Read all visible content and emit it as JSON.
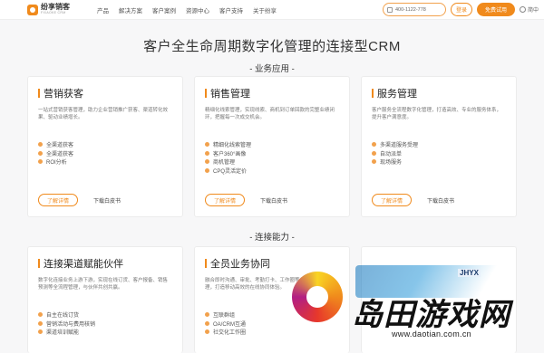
{
  "nav": {
    "logo_name": "纷享销客",
    "logo_sub": "FXIAOKE CRM",
    "menu": [
      "产品",
      "解决方案",
      "客户案例",
      "资源中心",
      "客户支持",
      "关于纷享"
    ],
    "phone_text": "400-1122-778",
    "login_label": "登录",
    "trial_label": "免费试用",
    "lang_label": "简中"
  },
  "hero": {
    "title": "客户全生命周期数字化管理的连接型CRM"
  },
  "sections": {
    "business": "- 业务应用 -",
    "connect": "- 连接能力 -"
  },
  "cards": [
    {
      "title": "营销获客",
      "desc": "一站式营销获客管理，助力企业营销推广获客、渠道转化效果、驱动业绩增长。",
      "features": [
        "全渠道获客",
        "全渠道获客",
        "ROI分析"
      ],
      "more_label": "了解详情",
      "wp_label": "下载白皮书"
    },
    {
      "title": "销售管理",
      "desc": "精细化线索管理，实现线索、商机到订单回款的完整业绩闭环，把握每一次成交机会。",
      "features": [
        "精细化线索管理",
        "客户360°画像",
        "商机管理",
        "CPQ灵活定价"
      ],
      "more_label": "了解详情",
      "wp_label": "下载白皮书"
    },
    {
      "title": "服务管理",
      "desc": "客户服务全流程数字化管理，打造高效、专业的服务体系，提升客户满意度。",
      "features": [
        "多渠道服务受理",
        "自动派单",
        "现场服务"
      ],
      "more_label": "了解详情",
      "wp_label": "下载白皮书"
    },
    {
      "title": "连接渠道赋能伙伴",
      "desc": "数字化连接业务上游下游，实现在线订货、客户报备、销售预测等全流程管理，与伙伴共创共赢。",
      "features": [
        "自主在线订货",
        "营销活动与费用核销",
        "渠道培训赋能"
      ]
    },
    {
      "title": "全员业务协同",
      "desc": "融合即时沟通、审批、考勤打卡、工作圈等一站式办公管理，打造移动高效的在线协同体验。",
      "features": [
        "互联群组",
        "OA/CRM互通",
        "社交化工作圈"
      ]
    }
  ],
  "watermark": {
    "brand": "岛田游戏网",
    "url": "www.daotian.com.cn",
    "tag": "JHYX"
  },
  "colors": {
    "accent": "#f08a1c"
  }
}
